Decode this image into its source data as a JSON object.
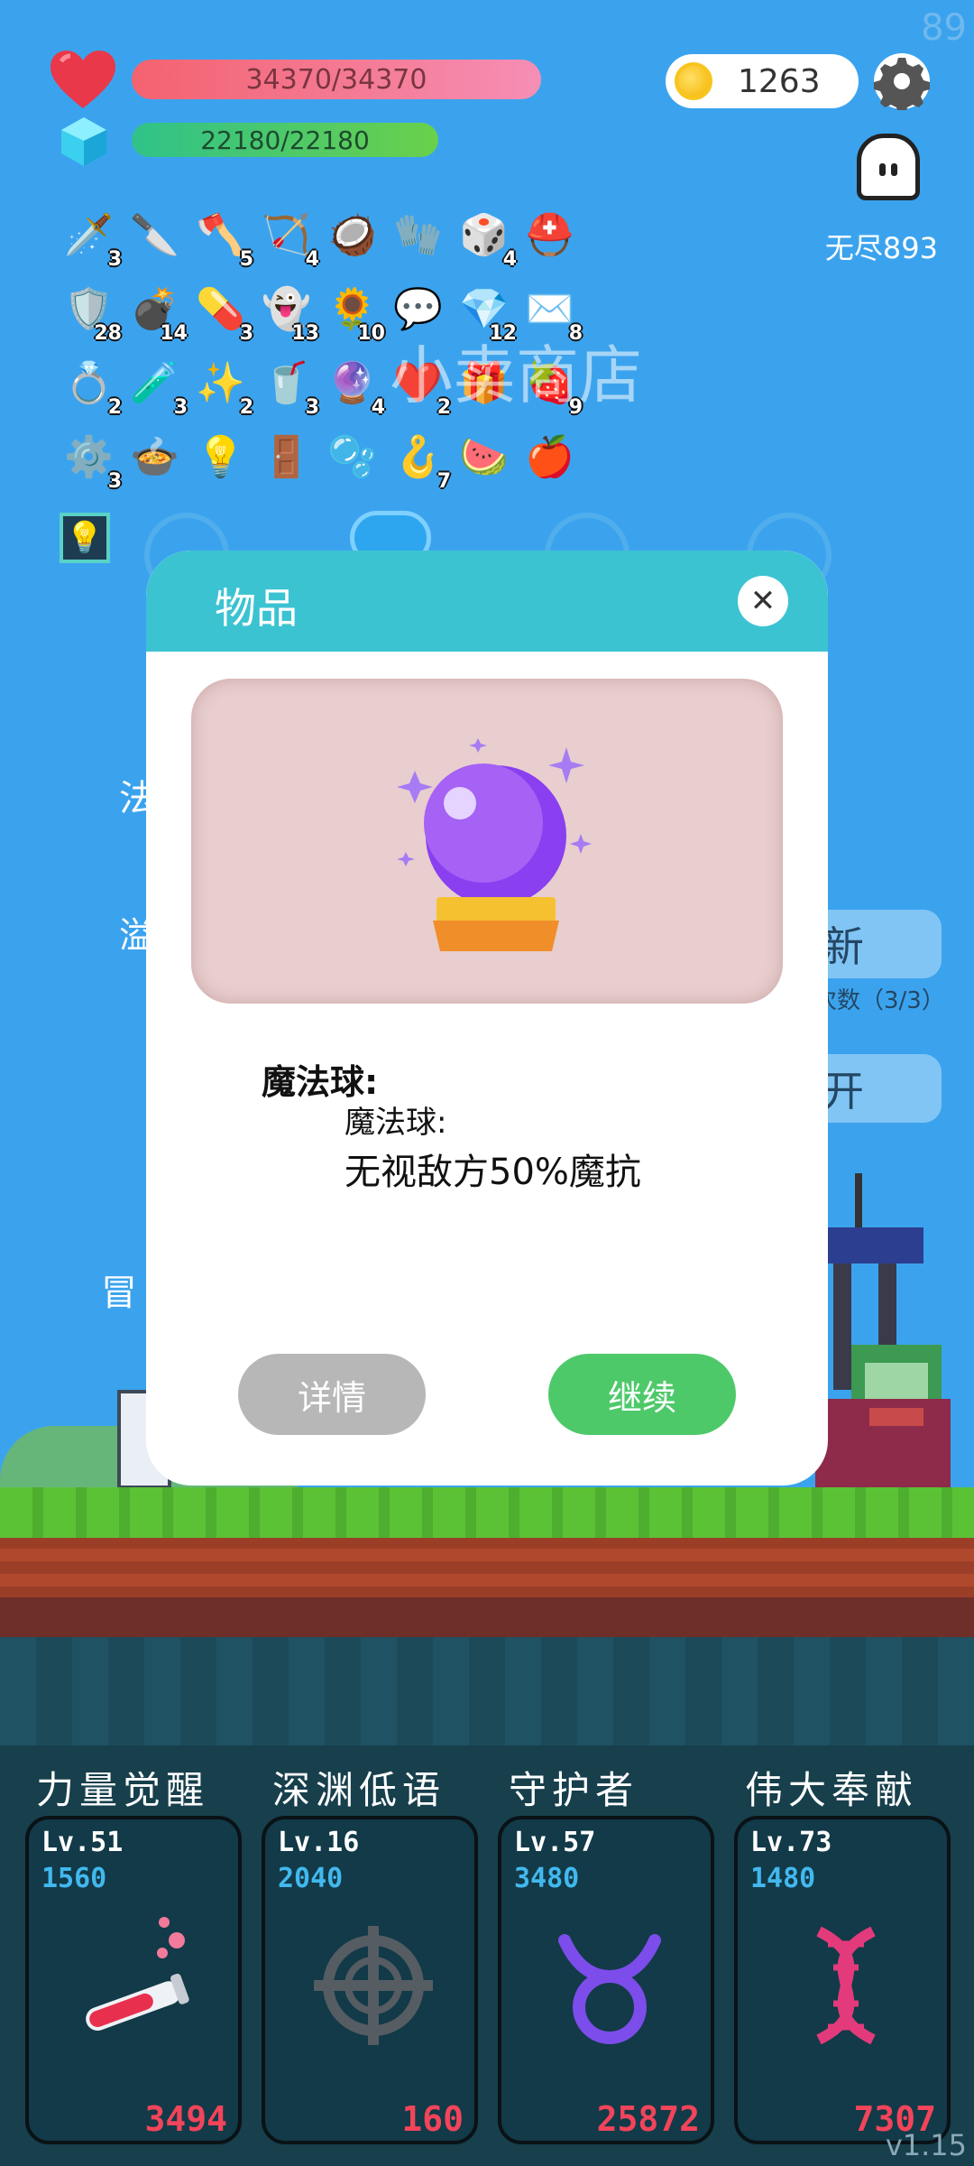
{
  "status": {
    "fps": "89",
    "hp": "34370/34370",
    "mana": "22180/22180",
    "coins": "1263",
    "mode_label": "无尽893"
  },
  "inventory": [
    {
      "icon": "🗡️",
      "count": "3"
    },
    {
      "icon": "🔪",
      "count": ""
    },
    {
      "icon": "🪓",
      "count": "5"
    },
    {
      "icon": "🏹",
      "count": "4"
    },
    {
      "icon": "🥥",
      "count": ""
    },
    {
      "icon": "🧤",
      "count": ""
    },
    {
      "icon": "🎲",
      "count": "4"
    },
    {
      "icon": "⛑️",
      "count": ""
    },
    {
      "icon": "🛡️",
      "count": "28"
    },
    {
      "icon": "💣",
      "count": "14"
    },
    {
      "icon": "💊",
      "count": "3"
    },
    {
      "icon": "👻",
      "count": "13"
    },
    {
      "icon": "🌻",
      "count": "10"
    },
    {
      "icon": "💬",
      "count": ""
    },
    {
      "icon": "💎",
      "count": "12"
    },
    {
      "icon": "✉️",
      "count": "8"
    },
    {
      "icon": "💍",
      "count": "2"
    },
    {
      "icon": "🧪",
      "count": "3"
    },
    {
      "icon": "✨",
      "count": "2"
    },
    {
      "icon": "🥤",
      "count": "3"
    },
    {
      "icon": "🔮",
      "count": "4"
    },
    {
      "icon": "❤️",
      "count": "2"
    },
    {
      "icon": "🎁",
      "count": ""
    },
    {
      "icon": "🍓",
      "count": "9"
    },
    {
      "icon": "⚙️",
      "count": "3"
    },
    {
      "icon": "🍲",
      "count": ""
    },
    {
      "icon": "💡",
      "count": ""
    },
    {
      "icon": "🚪",
      "count": ""
    },
    {
      "icon": "🫧",
      "count": ""
    },
    {
      "icon": "🪝",
      "count": "7"
    },
    {
      "icon": "🍉",
      "count": ""
    },
    {
      "icon": "🍎",
      "count": ""
    }
  ],
  "background": {
    "shop_name": "小卖商店",
    "left_label_1": "法",
    "left_label_2": "溢",
    "refresh_button": "新",
    "refresh_count": "次数（3/3）",
    "open_button": "开",
    "explore_label": "冒"
  },
  "modal": {
    "title": "物品",
    "item_name": "魔法球:",
    "item_subtitle": "魔法球:",
    "item_description": "无视敌方50%魔抗",
    "detail_button": "详情",
    "continue_button": "继续"
  },
  "skills": [
    {
      "name": "力量觉醒",
      "level": "Lv.51",
      "cost": "1560",
      "value": "3494",
      "icon": "potion-icon"
    },
    {
      "name": "深渊低语",
      "level": "Lv.16",
      "cost": "2040",
      "value": "160",
      "icon": "crosshair-icon"
    },
    {
      "name": "守护者",
      "level": "Lv.57",
      "cost": "3480",
      "value": "25872",
      "icon": "taurus-icon"
    },
    {
      "name": "伟大奉献",
      "level": "Lv.73",
      "cost": "1480",
      "value": "7307",
      "icon": "dna-icon"
    }
  ],
  "version": "v1.15",
  "colors": {
    "sky": "#3ba3ee",
    "modal_header": "#3cc3d2",
    "continue": "#4ec96a",
    "detail": "#b7b7b7",
    "skill_value": "#f2445a",
    "skill_cost": "#42b8ee"
  }
}
